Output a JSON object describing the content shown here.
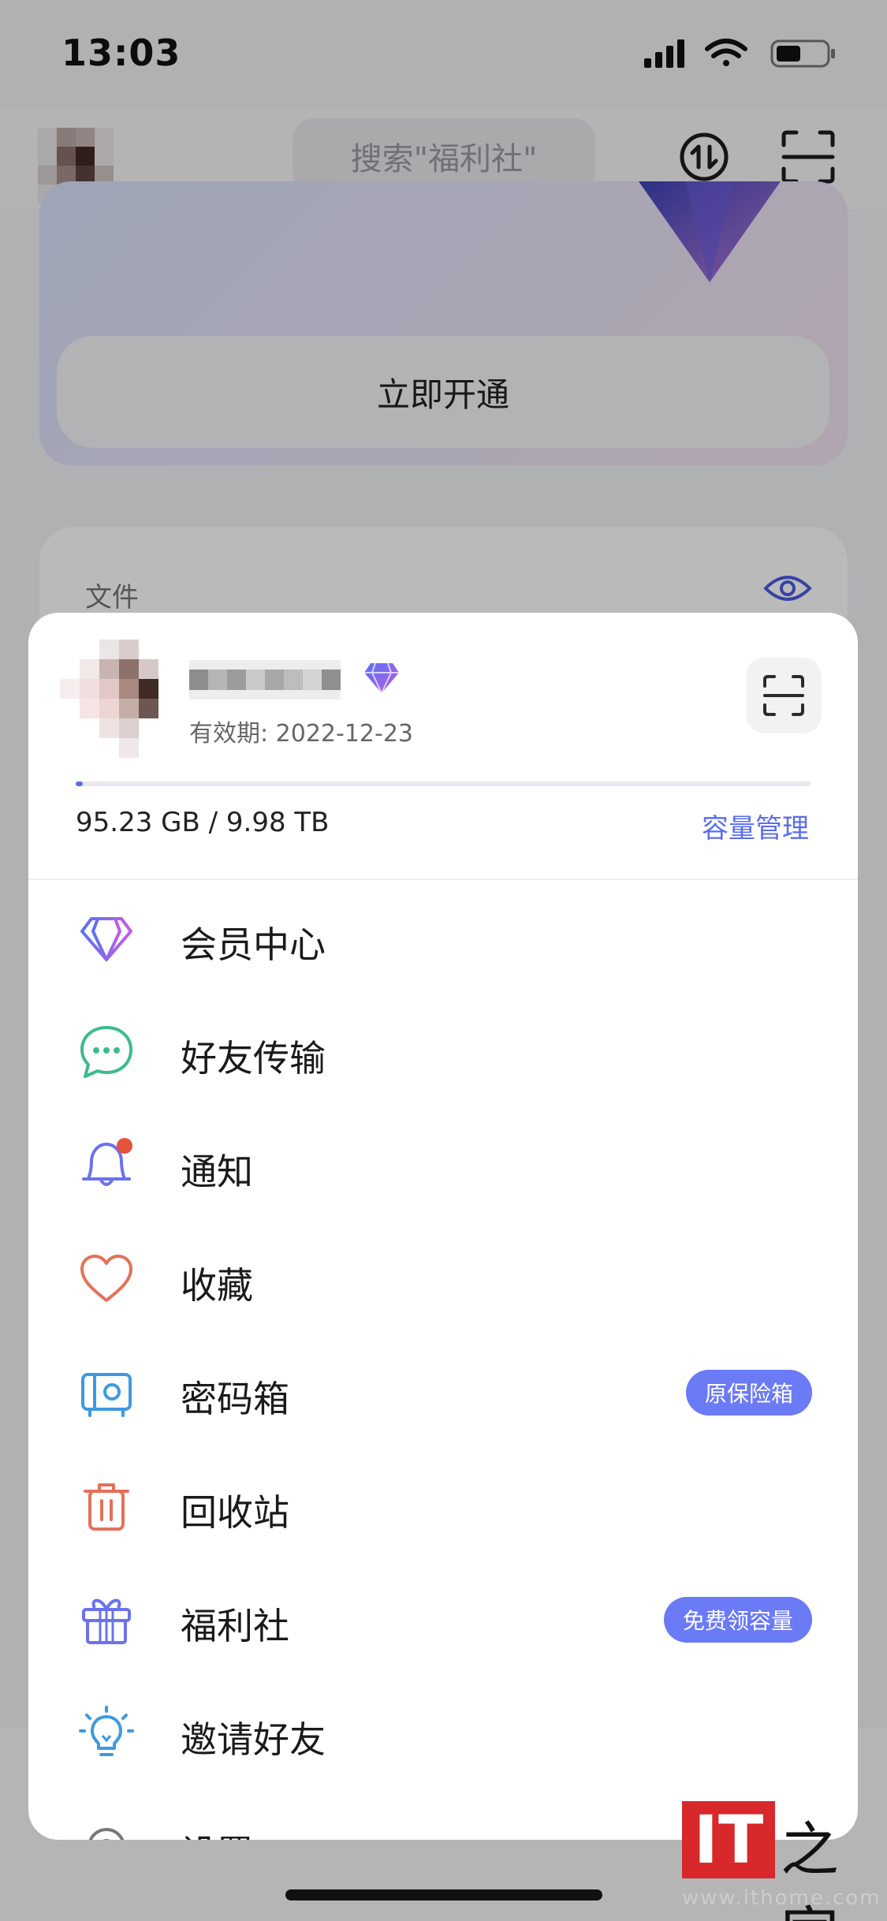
{
  "status_bar": {
    "time": "13:03"
  },
  "top_bar": {
    "search_placeholder": "搜索\"福利社\""
  },
  "vip_card": {
    "open_button": "立即开通"
  },
  "files_card": {
    "title": "文件"
  },
  "profile": {
    "expiry": "有效期: 2022-12-23",
    "capacity_text": "95.23 GB / 9.98 TB",
    "capacity_fraction": 0.0093,
    "capacity_manage": "容量管理"
  },
  "menu": [
    {
      "label": "会员中心",
      "icon": "diamond-icon"
    },
    {
      "label": "好友传输",
      "icon": "chat-bubble-icon"
    },
    {
      "label": "通知",
      "icon": "bell-icon"
    },
    {
      "label": "收藏",
      "icon": "heart-icon"
    },
    {
      "label": "密码箱",
      "icon": "safe-icon",
      "badge": "原保险箱"
    },
    {
      "label": "回收站",
      "icon": "trash-icon"
    },
    {
      "label": "福利社",
      "icon": "gift-icon",
      "badge": "免费领容量"
    },
    {
      "label": "邀请好友",
      "icon": "lightbulb-icon"
    },
    {
      "label": "设置",
      "icon": "gear-icon"
    }
  ],
  "watermark": {
    "brand": "IT",
    "name": "之家",
    "url": "www.ithome.com"
  },
  "colors": {
    "accent": "#5a6cf0",
    "badge": "#6b7af5",
    "notification_dot": "#e5533d"
  }
}
